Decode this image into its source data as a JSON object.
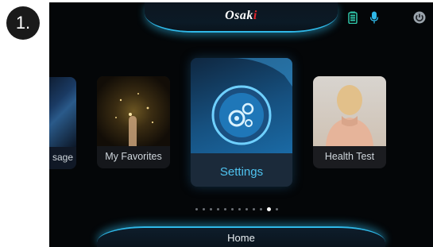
{
  "step": {
    "number": "1."
  },
  "header": {
    "brand": "Osaki",
    "icons": [
      "battery-icon",
      "microphone-icon",
      "power-icon"
    ]
  },
  "carousel": {
    "items": [
      {
        "label": "sage"
      },
      {
        "label": "My Favorites"
      },
      {
        "label": "Settings"
      },
      {
        "label": "Health Test"
      }
    ],
    "page_count": 12,
    "active_page": 10
  },
  "footer": {
    "home_label": "Home"
  },
  "colors": {
    "accent": "#2fb8e8",
    "brand_dot": "#e3262c",
    "settings_label": "#4fc3ef",
    "background": "#040608"
  }
}
